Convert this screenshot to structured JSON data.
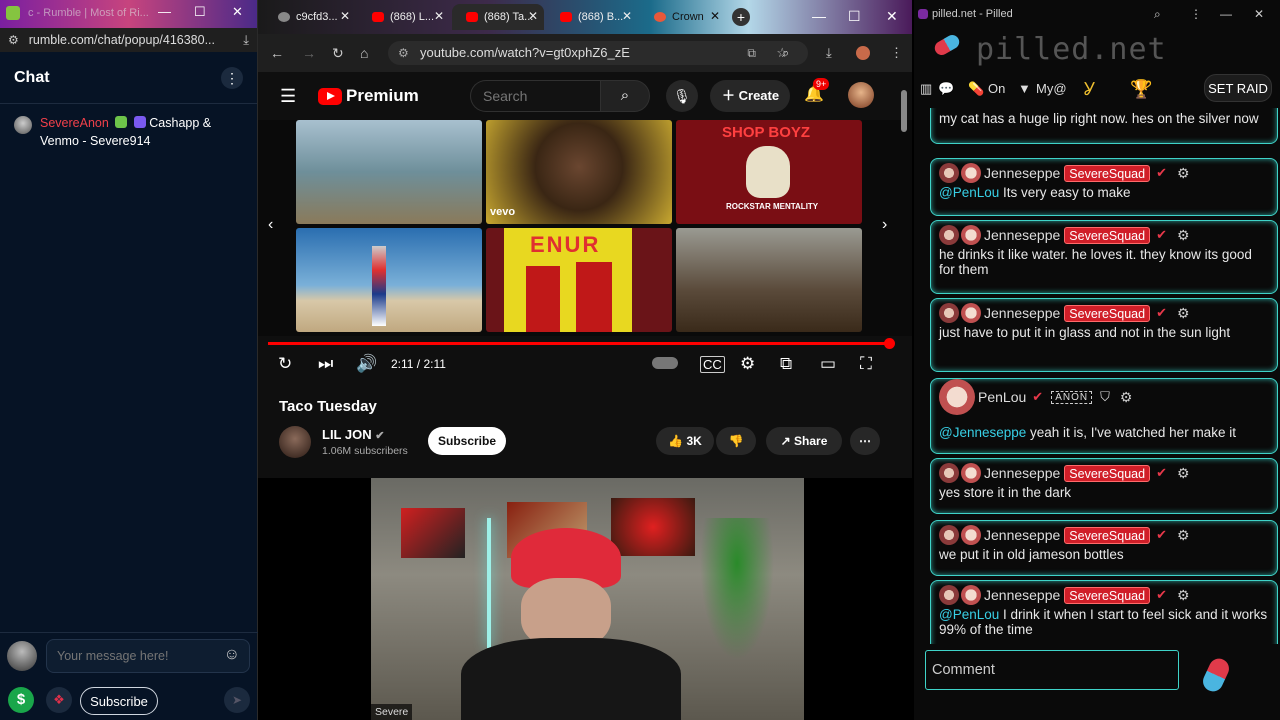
{
  "left_window": {
    "title": "c - Rumble | Most of Ri...",
    "url": "rumble.com/chat/popup/416380...",
    "chat": {
      "header": "Chat",
      "message": {
        "user": "SevereAnon",
        "text": "Cashapp & Venmo - Severe914"
      },
      "input_placeholder": "Your message here!",
      "subscribe_label": "Subscribe",
      "dollar_label": "$"
    }
  },
  "browser": {
    "tabs": [
      {
        "label": "c9cfd3...",
        "active": false
      },
      {
        "label": "(868) L...",
        "active": false
      },
      {
        "label": "(868) Ta...",
        "active": true
      },
      {
        "label": "(868) B...",
        "active": false
      },
      {
        "label": "Crown",
        "active": false
      }
    ],
    "url": "youtube.com/watch?v=gt0xphZ6_zE"
  },
  "youtube": {
    "brand": "Premium",
    "search_placeholder": "Search",
    "create_label": "Create",
    "notification_count": "9+",
    "endscreen_text": {
      "vevo": "vevo",
      "shopboyz": "SHOP BOYZ",
      "rockstar": "ROCKSTAR MENTALITY",
      "enur": "ENUR"
    },
    "player": {
      "time": "2:11 / 2:11",
      "progress": 1.0
    },
    "video": {
      "title": "Taco Tuesday",
      "channel": "LIL JON",
      "subscribers": "1.06M subscribers",
      "subscribe_label": "Subscribe",
      "likes": "3K",
      "share_label": "Share"
    }
  },
  "webcam": {
    "label": "Severe"
  },
  "pilled": {
    "window_title": "pilled.net - Pilled",
    "brand": "pilled.net",
    "toolbar": {
      "on_label": "On",
      "my_label": "My@",
      "raid_label": "SET RAID"
    },
    "messages": [
      {
        "user": "",
        "squad": "",
        "mention": "",
        "text": "my cat has a huge lip right now. hes on the silver now"
      },
      {
        "user": "Jenneseppe",
        "squad": "SevereSquad",
        "mention": "@PenLou",
        "text": " Its very easy to make"
      },
      {
        "user": "Jenneseppe",
        "squad": "SevereSquad",
        "mention": "",
        "text": "he drinks it like water. he loves it. they know its good for them"
      },
      {
        "user": "Jenneseppe",
        "squad": "SevereSquad",
        "mention": "",
        "text": "just have to put it in glass and not in the sun light"
      },
      {
        "user": "PenLou",
        "squad": "",
        "mention": "@Jenneseppe",
        "text": " yeah it is, I've watched her make it"
      },
      {
        "user": "Jenneseppe",
        "squad": "SevereSquad",
        "mention": "",
        "text": "yes store it in the dark"
      },
      {
        "user": "Jenneseppe",
        "squad": "SevereSquad",
        "mention": "",
        "text": "we put it in old jameson bottles"
      },
      {
        "user": "Jenneseppe",
        "squad": "SevereSquad",
        "mention": "@PenLou",
        "text": " I drink it when I start to feel sick and it works 99% of the time"
      }
    ],
    "penlou_badge": "ANON",
    "comment_placeholder": "Comment"
  }
}
